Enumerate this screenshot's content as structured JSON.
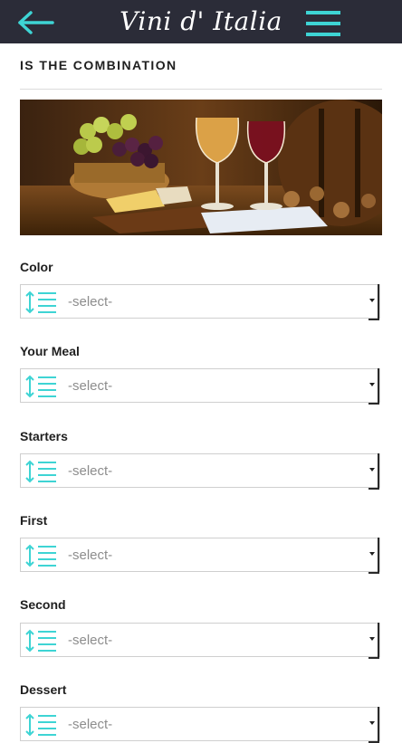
{
  "header": {
    "brand": "Vini d' Italia",
    "back_icon": "arrow-left-icon",
    "menu_icon": "hamburger-menu-icon",
    "accent_color": "#3ed4d4",
    "bar_color": "#2b2c38"
  },
  "section": {
    "title": "IS THE COMBINATION"
  },
  "hero": {
    "description_icon": "wine-and-cheese-photo"
  },
  "fields": [
    {
      "label": "Color",
      "value": "-select-"
    },
    {
      "label": "Your Meal",
      "value": "-select-"
    },
    {
      "label": "Starters",
      "value": "-select-"
    },
    {
      "label": "First",
      "value": "-select-"
    },
    {
      "label": "Second",
      "value": "-select-"
    },
    {
      "label": "Dessert",
      "value": "-select-"
    }
  ]
}
